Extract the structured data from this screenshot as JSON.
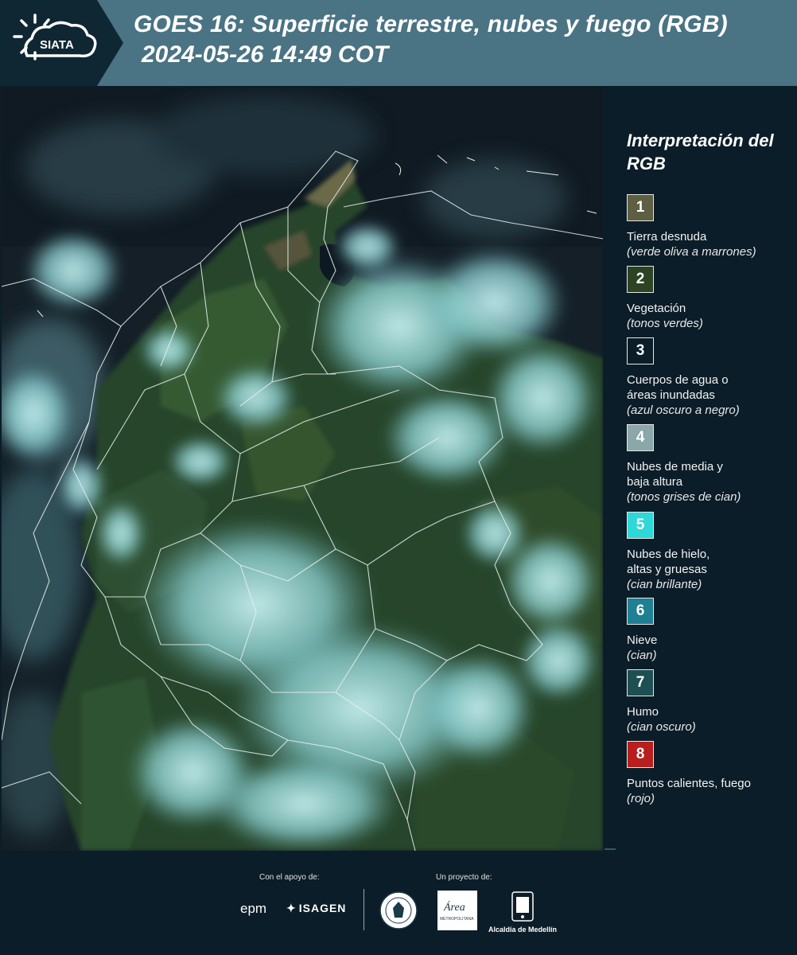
{
  "header": {
    "logo_text": "SIATA",
    "title": "GOES 16: Superficie terrestre, nubes y fuego (RGB)",
    "datetime": "2024-05-26 14:49 COT"
  },
  "legend": {
    "title": "Interpretación del RGB",
    "items": [
      {
        "number": "1",
        "label": "Tierra desnuda",
        "note": "(verde oliva a marrones)",
        "color": "#5e5e42"
      },
      {
        "number": "2",
        "label": "Vegetación",
        "note": "(tonos verdes)",
        "color": "#2c4324"
      },
      {
        "number": "3",
        "label": "Cuerpos de agua o áreas inundadas",
        "note": "(azul oscuro a negro)",
        "color": "#0b1d28"
      },
      {
        "number": "4",
        "label": "Nubes de media y baja altura",
        "note": "(tonos grises de cian)",
        "color": "#8aa7a9"
      },
      {
        "number": "5",
        "label": "Nubes de hielo, altas y gruesas",
        "note": "(cian brillante)",
        "color": "#2fd8d8"
      },
      {
        "number": "6",
        "label": "Nieve",
        "note": "(cian)",
        "color": "#1f7f93"
      },
      {
        "number": "7",
        "label": "Humo",
        "note": "(cian oscuro)",
        "color": "#1e4f52"
      },
      {
        "number": "8",
        "label": "Puntos calientes, fuego",
        "note": "(rojo)",
        "color": "#b81e1e"
      }
    ]
  },
  "footer": {
    "support_label": "Con el apoyo de:",
    "project_label": "Un proyecto de:",
    "sponsors": [
      "epm",
      "ISAGEN"
    ],
    "partners": [
      "Área Metropolitana",
      "Alcaldía de Medellín"
    ],
    "alcaldia_text": "Alcaldía de Medellín",
    "area_text": "Área",
    "area_subtext": "METROPOLITANA"
  }
}
